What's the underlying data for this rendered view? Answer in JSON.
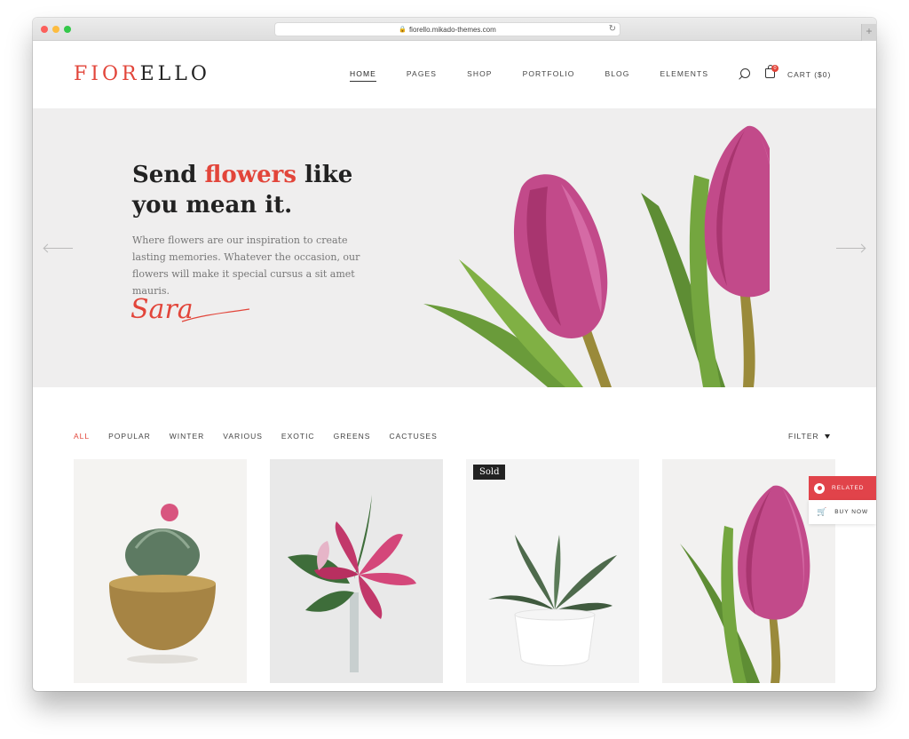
{
  "browser": {
    "url": "fiorello.mikado-themes.com"
  },
  "logo": {
    "accent": "FIOR",
    "rest": "ELLO"
  },
  "nav": {
    "items": [
      "HOME",
      "PAGES",
      "SHOP",
      "PORTFOLIO",
      "BLOG",
      "ELEMENTS"
    ],
    "active": "HOME"
  },
  "cart": {
    "label": "CART ($0)",
    "count": "0"
  },
  "hero": {
    "title_before": "Send ",
    "title_accent": "flowers",
    "title_after": " like",
    "title_line2": "you mean it.",
    "text": "Where flowers are our inspiration to create lasting memories. Whatever the occasion, our flowers will make it special cursus a sit amet mauris.",
    "signature": "Sara"
  },
  "filters": {
    "items": [
      "ALL",
      "POPULAR",
      "WINTER",
      "VARIOUS",
      "EXOTIC",
      "GREENS",
      "CACTUSES"
    ],
    "active": "ALL",
    "toggle_label": "FILTER"
  },
  "products": [
    {
      "image": "cactus in brass pot"
    },
    {
      "image": "pink lily in glass vase"
    },
    {
      "image": "succulent in white pot",
      "badge": "Sold"
    },
    {
      "image": "pink tulip"
    }
  ],
  "side_widget": {
    "related_label": "RELATED",
    "buy_label": "BUY NOW"
  },
  "colors": {
    "accent": "#e2453a",
    "hero_bg": "#efeeee",
    "widget_red": "#e1434a"
  }
}
